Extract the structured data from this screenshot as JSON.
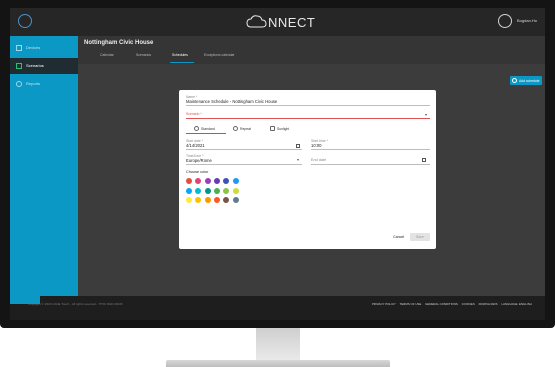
{
  "app": {
    "logo_text": "NNECT",
    "profile_name": "Bogdan.Ho"
  },
  "sidebar": {
    "items": [
      {
        "label": "Devices",
        "icon": "device-icon"
      },
      {
        "label": "Scenarios",
        "icon": "scenario-icon"
      },
      {
        "label": "Reports",
        "icon": "report-icon"
      }
    ]
  },
  "header": {
    "title": "Nottingham Civic House",
    "tabs": [
      "Calendar",
      "Scenarios",
      "Schedules",
      "Exceptions calendar"
    ]
  },
  "toolbar": {
    "add_label": "Add schedule"
  },
  "modal": {
    "name_label": "Name *",
    "name_value": "Maintenance Schedule - Nottingham Civic House",
    "scenario_label": "Scenario *",
    "schedule_types": [
      "Standard",
      "Repeat",
      "Sunlight"
    ],
    "start_date_label": "Start date *",
    "start_date_value": "4/14/2021",
    "start_time_label": "Start time *",
    "start_time_value": "10:00",
    "timezone_label": "TimeZone *",
    "timezone_value": "Europe/Rome",
    "end_date_placeholder": "End date",
    "color_label": "Choose color",
    "colors": [
      "#e74c3c",
      "#e0447a",
      "#9b3fb4",
      "#673ab7",
      "#3f51b5",
      "#2196f3",
      "#03a9f4",
      "#00bcd4",
      "#009688",
      "#4caf50",
      "#8bc34a",
      "#cddc39",
      "#ffeb3b",
      "#ffc107",
      "#ff9800",
      "#ff5722",
      "#795548",
      "#607d8b"
    ],
    "cancel_label": "Cancel",
    "save_label": "Save"
  },
  "footer": {
    "copyright": "Copyright © 2020 CANE Touch - All rights reserved - TITOI R&D 04935",
    "links": [
      "PRIVACY POLICY",
      "TERMS OF USE",
      "GENERAL CONDITIONS",
      "COOKIES",
      "DOWNLOADS",
      "LANGUAGE: ENGLISH"
    ]
  },
  "accent_colors": {
    "primary": "#0c98c4",
    "error": "#e05353"
  }
}
